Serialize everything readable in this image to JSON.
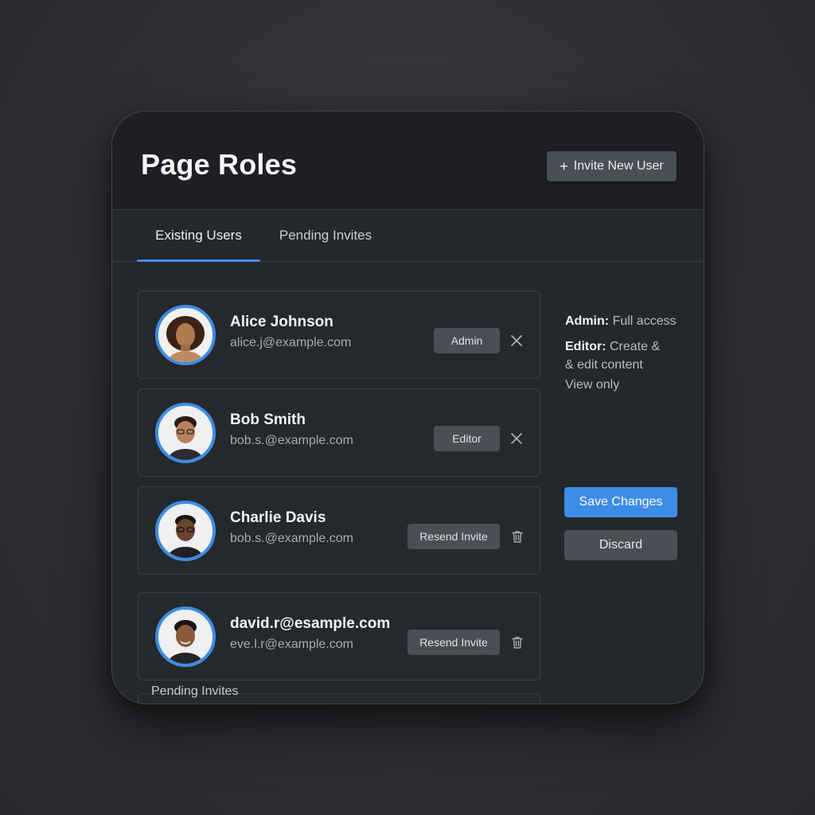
{
  "header": {
    "title": "Page Roles",
    "invite_button": "+ Invite New User",
    "invite_label": "Invite New User"
  },
  "tabs": [
    {
      "label": "Existing Users",
      "active": true
    },
    {
      "label": "Pending Invites",
      "active": false
    }
  ],
  "users": [
    {
      "name": "Alice Johnson",
      "email": "alice.j@example.com",
      "action": "Admin",
      "trailing_icon": "close-icon"
    },
    {
      "name": "Bob Smith",
      "email": "bob.s.@example.com",
      "action": "Editor",
      "trailing_icon": "close-icon"
    },
    {
      "name": "Charlie Davis",
      "email": "bob.s.@example.com",
      "action": "Resend Invite",
      "trailing_icon": "trash-icon"
    },
    {
      "name": "david.r@esample.com",
      "email": "eve.l.r@example.com",
      "action": "Resend Invite",
      "trailing_icon": "trash-icon"
    }
  ],
  "roles_legend": {
    "admin_label": "Admin:",
    "admin_desc": "Full access",
    "editor_label": "Editor:",
    "editor_desc_1": "Create &",
    "editor_desc_2": "& edit content",
    "viewer_desc": "View only"
  },
  "actions": {
    "save": "Save Changes",
    "discard": "Discard"
  },
  "pending_section_label": "Pending Invites",
  "colors": {
    "accent": "#3d8ce6",
    "panel": "#24272b",
    "header": "#1d1f22",
    "button": "#4a4e55"
  }
}
